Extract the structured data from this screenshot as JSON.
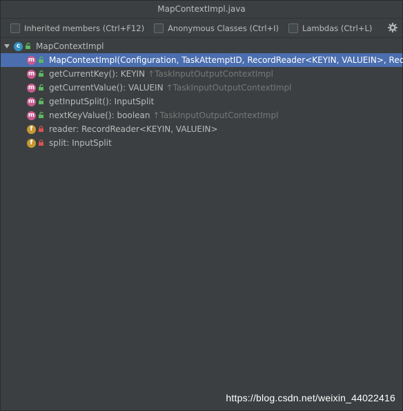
{
  "window": {
    "title": "MapContextImpl.java"
  },
  "toolbar": {
    "inherited_label": "Inherited members (Ctrl+F12)",
    "anonymous_label": "Anonymous Classes (Ctrl+I)",
    "lambdas_label": "Lambdas (Ctrl+L)",
    "settings_icon": "gear-icon"
  },
  "tree": {
    "root": {
      "icon": "class-icon",
      "label": "MapContextImpl"
    },
    "items": [
      {
        "kind": "m",
        "visibility": "public",
        "label": "MapContextImpl(Configuration, TaskAttemptID, RecordReader<KEYIN, VALUEIN>, Reco",
        "hint": "",
        "selected": true
      },
      {
        "kind": "m",
        "visibility": "public",
        "label": "getCurrentKey(): KEYIN",
        "hint": "↑TaskInputOutputContextImpl",
        "selected": false
      },
      {
        "kind": "m",
        "visibility": "public",
        "label": "getCurrentValue(): VALUEIN",
        "hint": "↑TaskInputOutputContextImpl",
        "selected": false
      },
      {
        "kind": "m",
        "visibility": "public",
        "label": "getInputSplit(): InputSplit",
        "hint": "",
        "selected": false
      },
      {
        "kind": "m",
        "visibility": "public",
        "label": "nextKeyValue(): boolean",
        "hint": "↑TaskInputOutputContextImpl",
        "selected": false
      },
      {
        "kind": "f",
        "visibility": "private",
        "label": "reader: RecordReader<KEYIN, VALUEIN>",
        "hint": "",
        "selected": false
      },
      {
        "kind": "f",
        "visibility": "private",
        "label": "split: InputSplit",
        "hint": "",
        "selected": false
      }
    ]
  },
  "watermark": "https://blog.csdn.net/weixin_44022416",
  "colors": {
    "background": "#3c3f41",
    "selection": "#4b6eaf",
    "method_badge": "#c75b8f",
    "field_badge": "#c79833",
    "class_badge": "#3592c4",
    "public_icon": "#5fb85f",
    "private_icon": "#d9534f"
  }
}
